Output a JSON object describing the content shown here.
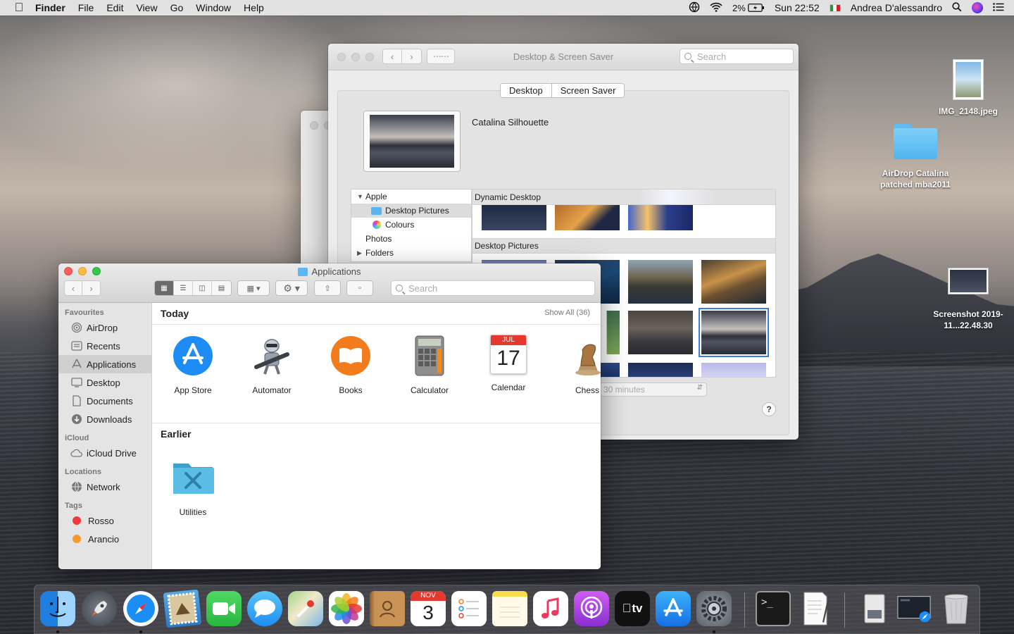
{
  "menubar": {
    "app_name": "Finder",
    "items": [
      "File",
      "Edit",
      "View",
      "Go",
      "Window",
      "Help"
    ],
    "battery": "2%",
    "clock": "Sun 22:52",
    "user": "Andrea D'alessandro"
  },
  "desktop_icons": [
    {
      "label": "IMG_2148.jpeg"
    },
    {
      "label": "AirDrop Catalina patched mba2011"
    },
    {
      "label": "Screenshot 2019-11...22.48.30"
    }
  ],
  "prefs": {
    "title": "Desktop & Screen Saver",
    "search_placeholder": "Search",
    "tabs": [
      "Desktop",
      "Screen Saver"
    ],
    "current_wallpaper": "Catalina Silhouette",
    "sources": {
      "apple": "Apple",
      "desktop_pictures": "Desktop Pictures",
      "colours": "Colours",
      "photos": "Photos",
      "folders": "Folders"
    },
    "dynamic_header": "Dynamic Desktop",
    "pictures_header": "Desktop Pictures",
    "interval": "30 minutes"
  },
  "finder": {
    "title": "Applications",
    "search_placeholder": "Search",
    "sidebar": {
      "favourites": "Favourites",
      "airdrop": "AirDrop",
      "recents": "Recents",
      "applications": "Applications",
      "desktop": "Desktop",
      "documents": "Documents",
      "downloads": "Downloads",
      "icloud": "iCloud",
      "icloud_drive": "iCloud Drive",
      "locations": "Locations",
      "network": "Network",
      "tags": "Tags",
      "rosso": "Rosso",
      "arancio": "Arancio"
    },
    "today_header": "Today",
    "show_all": "Show All (36)",
    "earlier_header": "Earlier",
    "apps_today": [
      "App Store",
      "Automator",
      "Books",
      "Calculator",
      "Calendar",
      "Chess"
    ],
    "apps_earlier": [
      "Utilities"
    ],
    "calendar_month": "JUL",
    "calendar_day": "17"
  },
  "dock": {
    "calendar_month": "NOV",
    "calendar_day": "3",
    "tv_label": "tv"
  }
}
